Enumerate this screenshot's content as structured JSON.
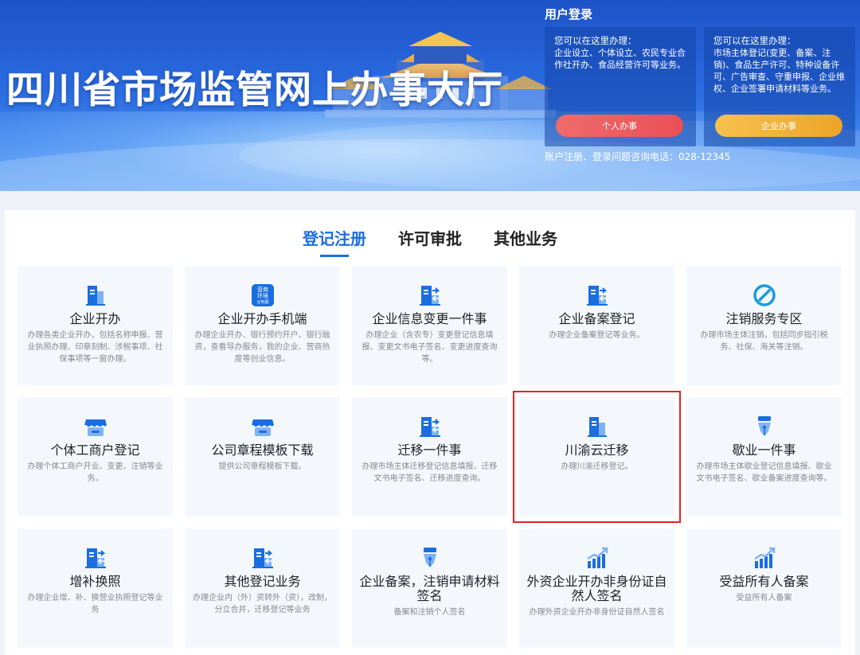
{
  "banner": {
    "title": "四川省市场监管网上办事大厅"
  },
  "login": {
    "title": "用户登录",
    "personal": {
      "intro": "您可以在这里办理：",
      "desc": "企业设立、个体设立、农民专业合作社开办、食品经营许可等业务。",
      "button": "个人办事"
    },
    "enterprise": {
      "intro": "您可以在这里办理：",
      "desc": "市场主体登记(变更、备案、注销)、食品生产许可、特种设备许可、广告审查、守重申报、企业维权、企业签署申请材料等业务。",
      "button": "企业办事"
    },
    "hotline": "账户注册、登录问题咨询电话：028-12345"
  },
  "tabs": [
    {
      "label": "登记注册",
      "active": true
    },
    {
      "label": "许可审批",
      "active": false
    },
    {
      "label": "其他业务",
      "active": false
    }
  ],
  "services": [
    {
      "name": "企业开办",
      "desc": "办理各类企业开办，包括名称申报、营业执照办理、印章刻制、涉税事项、社保事项等一窗办理。",
      "icon": "building-icon"
    },
    {
      "name": "企业开办手机端",
      "desc": "办理企业开办、银行预约开户、银行融资，查看导办服务，我的企业、营商热度等创业信息。",
      "icon": "mobile-app-icon",
      "icon_text": [
        "营商",
        "环境",
        "云地图"
      ]
    },
    {
      "name": "企业信息变更一件事",
      "desc": "办理企业（含农专）变更登记信息填报、变更文书电子签名、变更进度查询等。",
      "icon": "transfer-building-icon"
    },
    {
      "name": "企业备案登记",
      "desc": "办理企业备案登记等业务。",
      "icon": "transfer-building-icon"
    },
    {
      "name": "注销服务专区",
      "desc": "办理市场主体注销，包括同步指引税务、社保、海关等注销。",
      "icon": "cancel-icon"
    },
    {
      "name": "个体工商户登记",
      "desc": "办理个体工商户开业、变更、注销等业务。",
      "icon": "shop-icon"
    },
    {
      "name": "公司章程模板下载",
      "desc": "提供公司章程模板下载。",
      "icon": "shop-icon"
    },
    {
      "name": "迁移一件事",
      "desc": "办理市场主体迁移登记信息填报、迁移文书电子签名、迁移进度查询。",
      "icon": "transfer-building-icon"
    },
    {
      "name": "川渝云迁移",
      "desc": "办理川渝迁移登记。",
      "icon": "building-icon",
      "highlighted": true
    },
    {
      "name": "歇业一件事",
      "desc": "办理市场主体歇业登记信息填报、歇业文书电子签名、歇业备案进度查询等。",
      "icon": "pen-nib-icon"
    },
    {
      "name": "增补换照",
      "desc": "办理企业增、补、换营业执照登记等业务",
      "icon": "transfer-building-icon"
    },
    {
      "name": "其他登记业务",
      "desc": "办理企业内（外）资转外（资），改制，分立合并，迁移登记等业务",
      "icon": "transfer-building-icon"
    },
    {
      "name": "企业备案，注销申请材料签名",
      "desc": "备案和注销个人签名",
      "icon": "pen-nib-icon"
    },
    {
      "name": "外资企业开办非身份证自然人签名",
      "desc": "办理外资企业开办非身份证自然人签名",
      "icon": "growth-chart-icon"
    },
    {
      "name": "受益所有人备案",
      "desc": "受益所有人备案",
      "icon": "growth-chart-icon"
    }
  ],
  "colors": {
    "accent": "#1a6ee0",
    "personal_button": "#ea4f57",
    "enterprise_button": "#eca42a",
    "highlight_border": "#e02424"
  }
}
